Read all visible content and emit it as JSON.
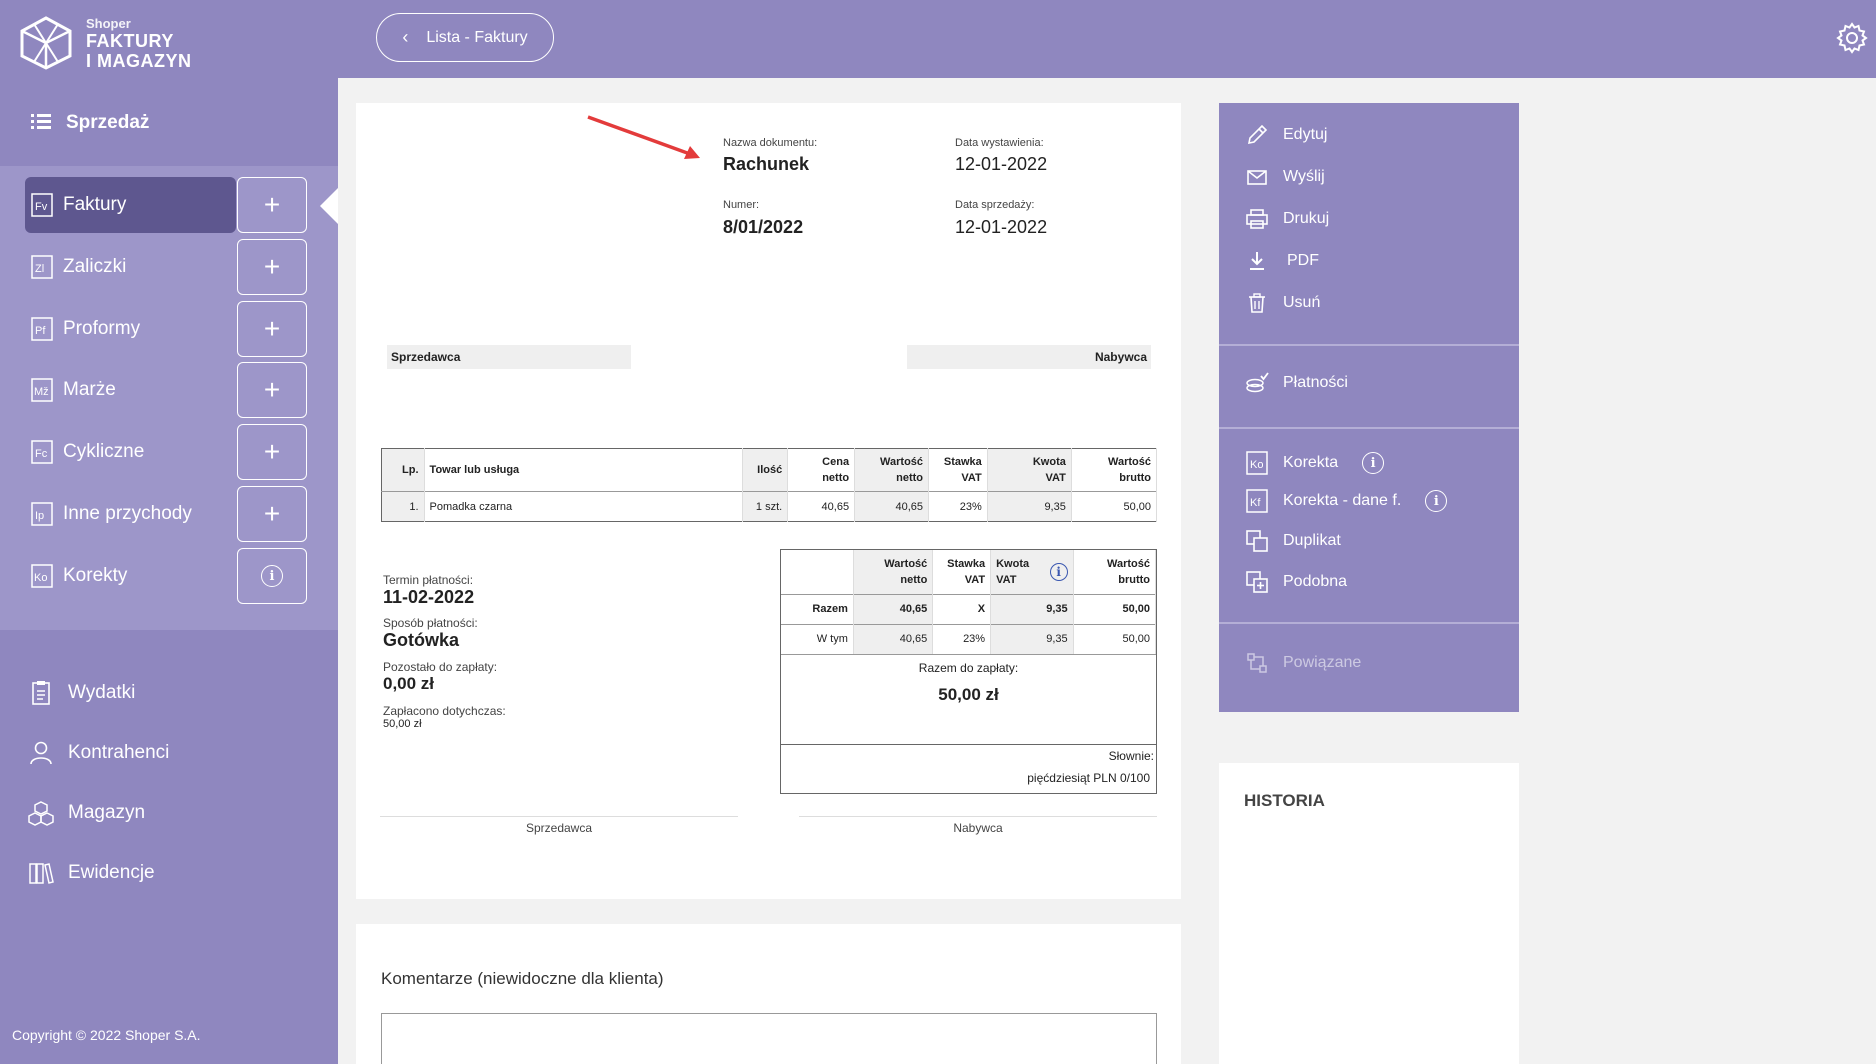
{
  "sidebar": {
    "logo": {
      "small": "Shoper",
      "line1": "FAKTURY",
      "line2": "I MAGAZYN"
    },
    "section": "Sprzedaż",
    "sales_items": [
      {
        "label": "Faktury",
        "icon": "Fv",
        "action": "+"
      },
      {
        "label": "Zaliczki",
        "icon": "Zl",
        "action": "+"
      },
      {
        "label": "Proformy",
        "icon": "Pf",
        "action": "+"
      },
      {
        "label": "Marże",
        "icon": "Mž",
        "action": "+"
      },
      {
        "label": "Cykliczne",
        "icon": "Fc",
        "action": "+"
      },
      {
        "label": "Inne przychody",
        "icon": "Ip",
        "action": "+"
      },
      {
        "label": "Korekty",
        "icon": "Ko",
        "action": "i"
      }
    ],
    "main_items": [
      "Wydatki",
      "Kontrahenci",
      "Magazyn",
      "Ewidencje"
    ],
    "copyright": "Copyright © 2022 Shoper S.A."
  },
  "topbar": {
    "back_label": "Lista - Faktury"
  },
  "document": {
    "name_label": "Nazwa dokumentu:",
    "name": "Rachunek",
    "issue_label": "Data wystawienia:",
    "issue_date": "12-01-2022",
    "number_label": "Numer:",
    "number": "8/01/2022",
    "sale_label": "Data sprzedaży:",
    "sale_date": "12-01-2022",
    "seller": "Sprzedawca",
    "buyer": "Nabywca",
    "items_headers": {
      "lp": "Lp.",
      "name": "Towar lub usługa",
      "qty": "Ilość",
      "net_price": "Cena netto",
      "net_value": "Wartość netto",
      "vat_rate_1": "Stawka",
      "vat_rate_2": "VAT",
      "vat_amount_1": "Kwota",
      "vat_amount_2": "VAT",
      "gross_1": "Wartość",
      "gross_2": "brutto"
    },
    "items": [
      {
        "lp": "1.",
        "name": "Pomadka czarna",
        "qty": "1 szt.",
        "net_price": "40,65",
        "net_value": "40,65",
        "vat_rate": "23%",
        "vat_amount": "9,35",
        "gross": "50,00"
      }
    ],
    "terms": {
      "due_label": "Termin płatności:",
      "due": "11-02-2022",
      "method_label": "Sposób płatności:",
      "method": "Gotówka",
      "remaining_label": "Pozostało do zapłaty:",
      "remaining": "0,00 zł",
      "paid_label": "Zapłacono dotychczas:",
      "paid": "50,00 zł"
    },
    "summary": {
      "headers": {
        "net_value": "Wartość netto",
        "vat_rate_1": "Stawka",
        "vat_rate_2": "VAT",
        "vat_amount_1": "Kwota",
        "vat_amount_2": "VAT",
        "gross_1": "Wartość",
        "gross_2": "brutto"
      },
      "total": {
        "label": "Razem",
        "net": "40,65",
        "rate": "X",
        "vat": "9,35",
        "gross": "50,00"
      },
      "incl": {
        "label": "W tym",
        "net": "40,65",
        "rate": "23%",
        "vat": "9,35",
        "gross": "50,00"
      },
      "to_pay_label": "Razem do zapłaty:",
      "to_pay": "50,00 zł",
      "words_label": "Słownie:",
      "words": "pięćdziesiąt PLN 0/100"
    },
    "sign_seller": "Sprzedawca",
    "sign_buyer": "Nabywca"
  },
  "comments": {
    "title": "Komentarze (niewidoczne dla klienta)"
  },
  "actions": {
    "edit": "Edytuj",
    "send": "Wyślij",
    "print": "Drukuj",
    "pdf": "PDF",
    "delete": "Usuń",
    "payments": "Płatności",
    "correction": "Korekta",
    "correction_data": "Korekta - dane f.",
    "duplicate": "Duplikat",
    "similar": "Podobna",
    "related": "Powiązane"
  },
  "history": {
    "title": "HISTORIA"
  },
  "colors": {
    "brand": "#8f87bf",
    "active": "#5e578f",
    "subnav": "#9d96c9",
    "annotation_arrow": "#e33b3b"
  }
}
